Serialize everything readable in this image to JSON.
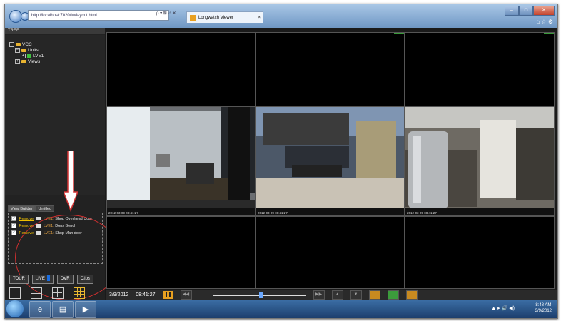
{
  "browser": {
    "url": "http://localhost:7020/lw/layout.html",
    "address_controls": "ρ ▾ ⊠ ♂ ✕",
    "tab_title": "Longwatch Viewer",
    "tab_close": "×",
    "window_buttons": [
      "–",
      "□",
      "✕"
    ],
    "home_icons": "⌂ ☆ ⚙"
  },
  "left_panel": {
    "tree_header": "TREE",
    "tree": {
      "root": "VCC",
      "units": "Units",
      "unit_item": "LVE1",
      "views": "Views"
    },
    "view_builder_tabs": [
      "View Builder",
      "Untitled"
    ],
    "view_builder_rows": [
      {
        "action": "Remove",
        "unit": "LVE1:",
        "camera": "Shop Overhead Door"
      },
      {
        "action": "Remove",
        "unit": "LVE1:",
        "camera": "Dons Bench"
      },
      {
        "action": "Remove",
        "unit": "LVE1:",
        "camera": "Shop Man door"
      }
    ],
    "mode_buttons": [
      "TOUR",
      "LIVE",
      "DVR",
      "Clips"
    ],
    "layout_buttons": [
      "single-layout-icon",
      "dual-layout-icon",
      "quad-layout-icon",
      "grid-9-layout-icon"
    ]
  },
  "video": {
    "timestamps": [
      "2012-03-09 08:41:27",
      "2012-03-09 08:41:27",
      "2012-03-09 08:41:27"
    ]
  },
  "controls": {
    "date": "3/9/2012",
    "time": "08:41:27"
  },
  "taskbar": {
    "tray": "▲ ▸ 🔊 ◀)",
    "time": "8:48 AM",
    "date": "3/9/2012"
  },
  "colors": {
    "accent": "#e8a020",
    "annotation": "#d03030",
    "live_indicator": "#1a6de0"
  }
}
